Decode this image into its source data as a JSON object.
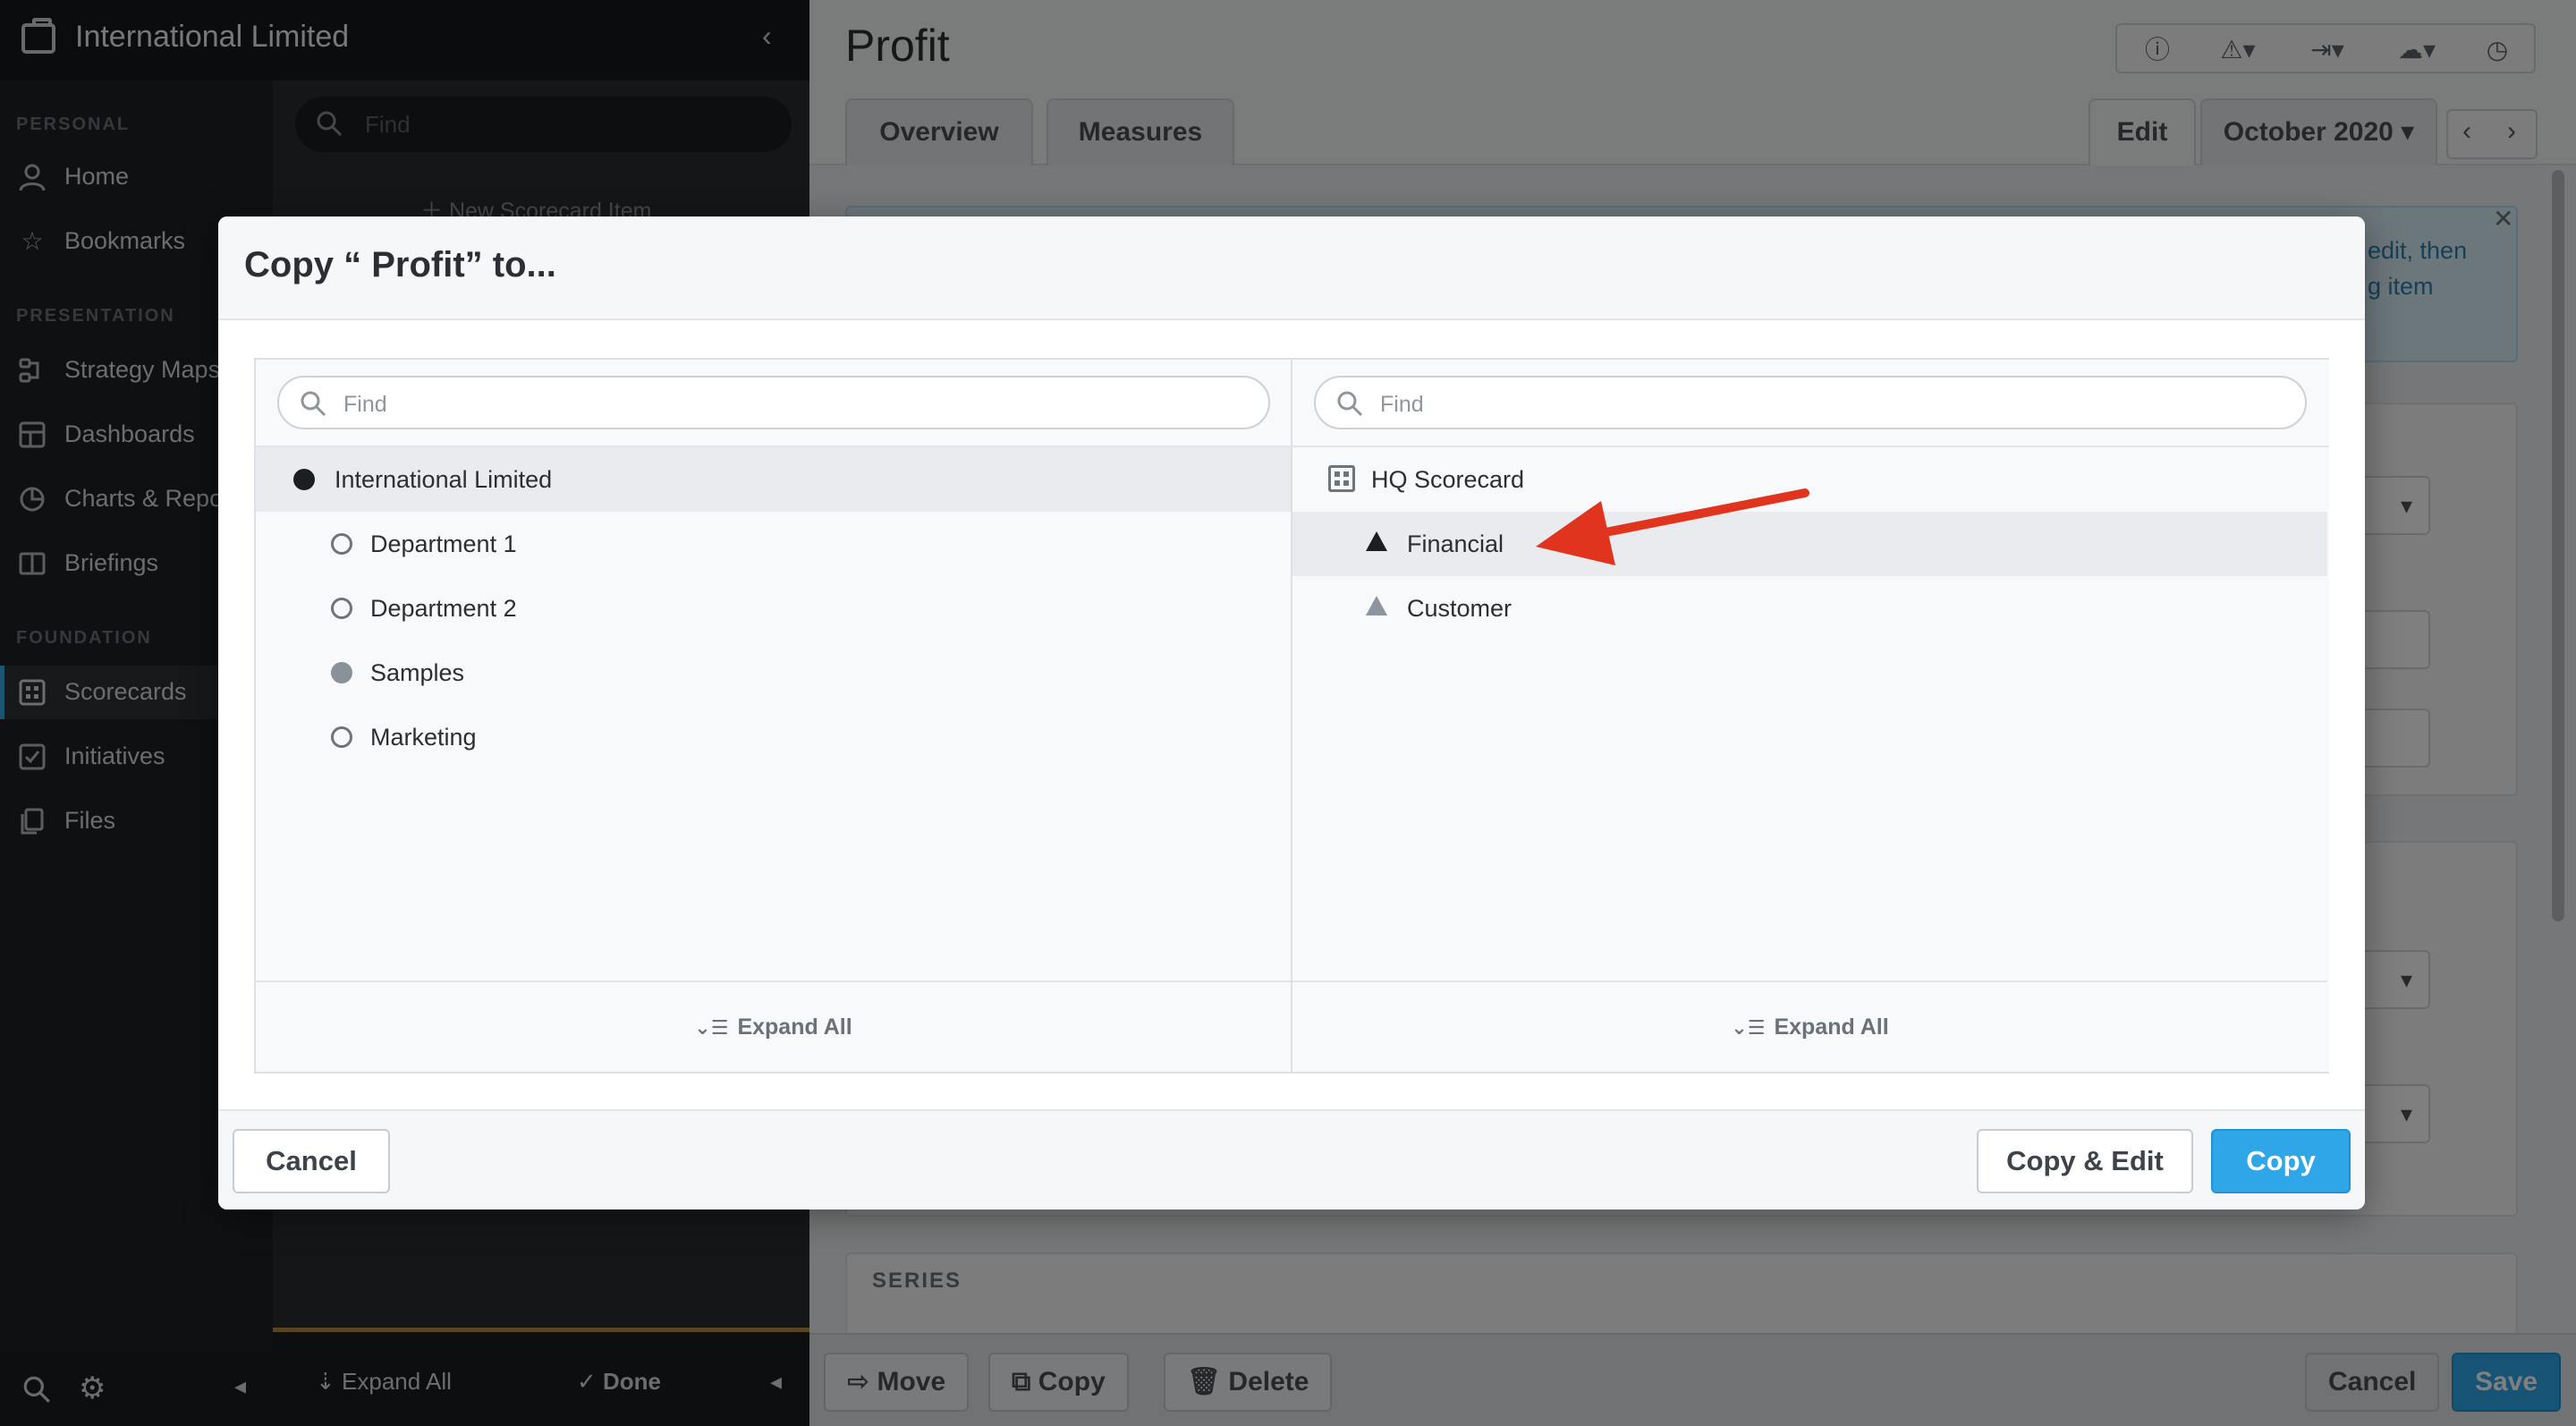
{
  "colors": {
    "accent": "#2ea6e8",
    "arrow": "#e1341e",
    "sidebar_bg": "#1e2125"
  },
  "sidebar": {
    "org_title": "International Limited",
    "search_placeholder": "Find",
    "new_item": "New Scorecard Item",
    "sections": {
      "personal": "PERSONAL",
      "presentation": "PRESENTATION",
      "foundation": "FOUNDATION"
    },
    "items": [
      {
        "label": "Home",
        "icon": "person-icon"
      },
      {
        "label": "Bookmarks",
        "icon": "star-icon"
      },
      {
        "label": "Strategy Maps",
        "icon": "strategy-map-icon"
      },
      {
        "label": "Dashboards",
        "icon": "dashboard-icon"
      },
      {
        "label": "Charts & Reports",
        "icon": "pie-chart-icon"
      },
      {
        "label": "Briefings",
        "icon": "book-icon"
      },
      {
        "label": "Scorecards",
        "icon": "scorecard-icon"
      },
      {
        "label": "Initiatives",
        "icon": "checkbox-icon"
      },
      {
        "label": "Files",
        "icon": "files-icon"
      }
    ],
    "bottom": {
      "expand_all": "Expand All",
      "done": "Done"
    }
  },
  "main": {
    "title": "Profit",
    "tabs": [
      "Overview",
      "Measures"
    ],
    "edit_tab": "Edit",
    "period": "October 2020",
    "banner_text": [
      "edit, then",
      "g item"
    ],
    "series_label": "SERIES",
    "footer": {
      "move": "Move",
      "copy": "Copy",
      "delete": "Delete",
      "cancel": "Cancel",
      "save": "Save"
    }
  },
  "modal": {
    "title": "Copy “ Profit” to...",
    "left": {
      "find_placeholder": "Find",
      "items": [
        {
          "label": "International Limited",
          "marker": "filled"
        },
        {
          "label": "Department 1",
          "marker": "hollow"
        },
        {
          "label": "Department 2",
          "marker": "hollow"
        },
        {
          "label": "Samples",
          "marker": "gray"
        },
        {
          "label": "Marketing",
          "marker": "hollow"
        }
      ],
      "expand_all": "Expand All"
    },
    "right": {
      "find_placeholder": "Find",
      "items": [
        {
          "label": "HQ Scorecard",
          "marker": "scorecard"
        },
        {
          "label": "Financial",
          "marker": "triangle-dark"
        },
        {
          "label": "Customer",
          "marker": "triangle-gray"
        }
      ],
      "expand_all": "Expand All"
    },
    "buttons": {
      "cancel": "Cancel",
      "copy_edit": "Copy & Edit",
      "copy": "Copy"
    }
  }
}
